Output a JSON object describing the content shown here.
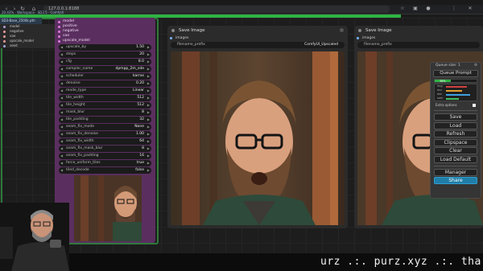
{
  "browser": {
    "url": "127.0.0.1:8188",
    "status_text": "20.43% · Workspace · SD3.5 · ComfyUI",
    "progress_percent": 83
  },
  "loader": {
    "header": "SD3-Base_2500k.pth",
    "rows": [
      "model",
      "negative",
      "vae",
      "upscale_model",
      "seed"
    ]
  },
  "ksampler": {
    "inputs": [
      "model",
      "positive",
      "negative",
      "vae",
      "upscale_model",
      "seed"
    ],
    "widgets": [
      {
        "label": "upscale_by",
        "value": "1.50"
      },
      {
        "label": "steps",
        "value": "20"
      },
      {
        "label": "cfg",
        "value": "8.0"
      },
      {
        "label": "sampler_name",
        "value": "dpmpp_2m_sde"
      },
      {
        "label": "scheduler",
        "value": "karras"
      },
      {
        "label": "denoise",
        "value": "0.20"
      },
      {
        "label": "mode_type",
        "value": "Linear"
      },
      {
        "label": "tile_width",
        "value": "512"
      },
      {
        "label": "tile_height",
        "value": "512"
      },
      {
        "label": "mask_blur",
        "value": "8"
      },
      {
        "label": "tile_padding",
        "value": "32"
      },
      {
        "label": "seam_fix_mode",
        "value": "None"
      },
      {
        "label": "seam_fix_denoise",
        "value": "1.00"
      },
      {
        "label": "seam_fix_width",
        "value": "64"
      },
      {
        "label": "seam_fix_mask_blur",
        "value": "8"
      },
      {
        "label": "seam_fix_padding",
        "value": "16"
      },
      {
        "label": "force_uniform_tiles",
        "value": "true"
      },
      {
        "label": "tiled_decode",
        "value": "false"
      }
    ]
  },
  "save_nodes": [
    {
      "title": "Save Image",
      "input": "images",
      "fname_label": "filename_prefix",
      "fname_value": "ComfyUI_Upscaled"
    },
    {
      "title": "Save Image",
      "input": "images",
      "fname_label": "filename_prefix",
      "fname_value": ""
    }
  ],
  "queue": {
    "header": "Queue size: 1",
    "queue_prompt": "Queue Prompt",
    "progress_label": "38%",
    "progress_value": 0.38,
    "list_rows": [
      "img",
      "enc",
      "dec",
      "sam"
    ],
    "extra_options": "Extra options",
    "buttons": [
      "Save",
      "Load",
      "Refresh",
      "Clipspace",
      "Clear",
      "Load Default"
    ],
    "manager": "Manager",
    "share": "Share"
  },
  "bottom_ticker": "urz .:. purz.xyz .:. than"
}
